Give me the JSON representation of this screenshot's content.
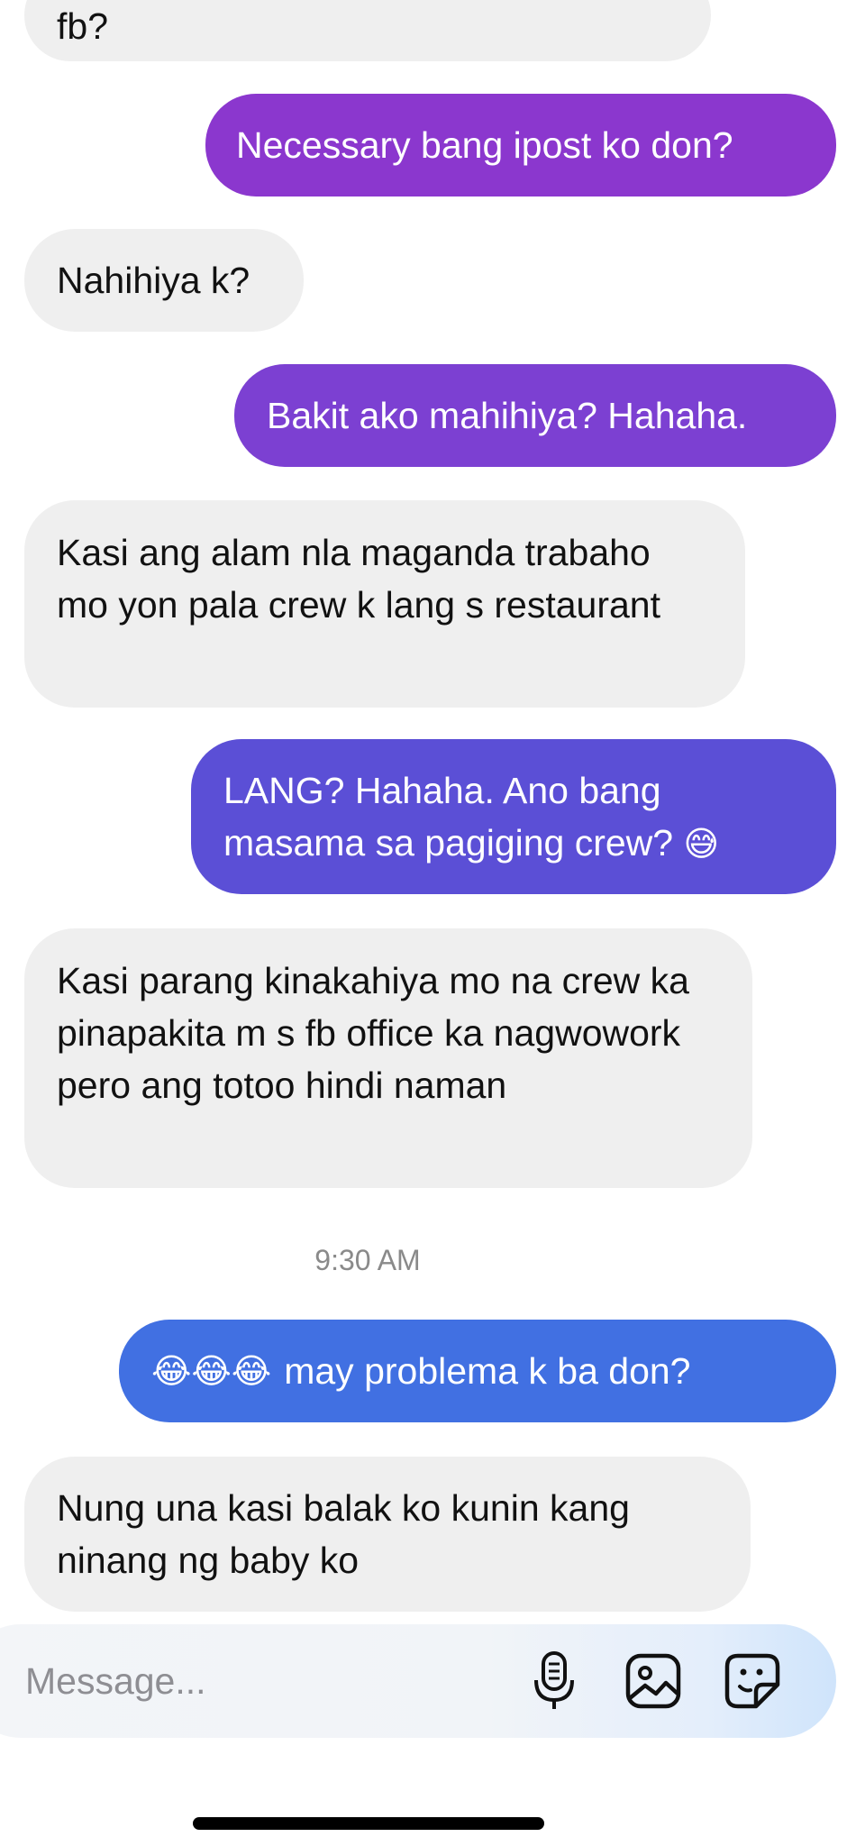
{
  "messages": [
    {
      "sender": "other",
      "text": "fb?"
    },
    {
      "sender": "me",
      "text": "Necessary bang ipost ko don?",
      "color": "#8b37ce"
    },
    {
      "sender": "other",
      "text": "Nahihiya k?"
    },
    {
      "sender": "me",
      "text": "Bakit ako mahihiya? Hahaha.",
      "color": "#7c40d2"
    },
    {
      "sender": "other",
      "text": "Kasi ang alam nla maganda trabaho mo yon pala crew k lang s restaurant"
    },
    {
      "sender": "me",
      "text": "LANG? Hahaha. Ano bang masama sa pagiging crew?",
      "emoji": "😅",
      "color": "#5b4fd6"
    },
    {
      "sender": "other",
      "text": "Kasi parang kinakahiya mo na crew ka pinapakita m s fb office ka nagwowork pero ang totoo hindi naman"
    },
    {
      "sender": "me",
      "emoji": "😂😂😂",
      "text": "may problema k ba don?",
      "color": "#4170e2"
    },
    {
      "sender": "other",
      "text": "Nung una kasi balak ko kunin kang ninang ng baby ko"
    }
  ],
  "timestamp": "9:30 AM",
  "composer": {
    "placeholder": "Message...",
    "icons": [
      "microphone-icon",
      "gallery-icon",
      "sticker-icon"
    ]
  }
}
